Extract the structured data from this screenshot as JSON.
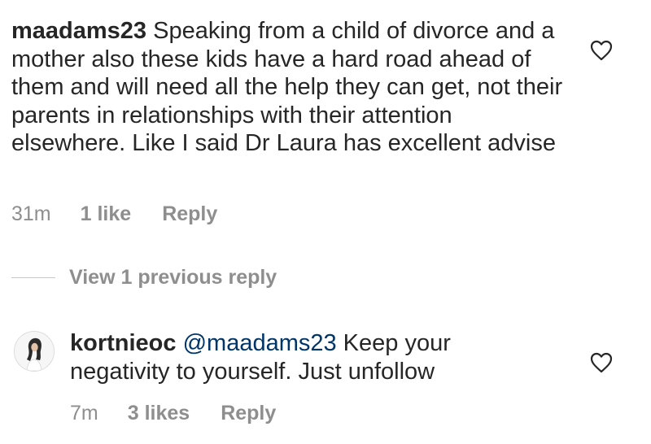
{
  "comments": [
    {
      "username": "maadams23",
      "text": " Speaking from a child of divorce and a mother also these kids have a hard road ahead of them and will need all the help they can get, not their parents in relationships with their attention elsewhere. Like I said Dr Laura has excellent advise",
      "time": "31m",
      "likes": "1 like",
      "reply_label": "Reply",
      "icon": "heart-outline-icon"
    },
    {
      "username": "kortnieoc",
      "mention": "@maadams23",
      "text": " Keep your negativity to yourself. Just unfollow",
      "time": "7m",
      "likes": "3 likes",
      "reply_label": "Reply",
      "icon": "heart-outline-icon"
    }
  ],
  "view_replies_label": "View 1 previous reply",
  "colors": {
    "text": "#262626",
    "secondary": "#8e8e8e",
    "mention": "#003569",
    "divider": "#c7c7c7"
  }
}
